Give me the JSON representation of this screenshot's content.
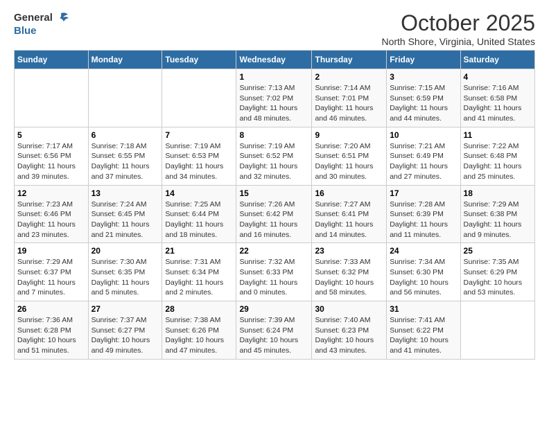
{
  "header": {
    "logo_line1": "General",
    "logo_line2": "Blue",
    "month": "October 2025",
    "location": "North Shore, Virginia, United States"
  },
  "weekdays": [
    "Sunday",
    "Monday",
    "Tuesday",
    "Wednesday",
    "Thursday",
    "Friday",
    "Saturday"
  ],
  "weeks": [
    [
      {
        "day": "",
        "content": ""
      },
      {
        "day": "",
        "content": ""
      },
      {
        "day": "",
        "content": ""
      },
      {
        "day": "1",
        "content": "Sunrise: 7:13 AM\nSunset: 7:02 PM\nDaylight: 11 hours and 48 minutes."
      },
      {
        "day": "2",
        "content": "Sunrise: 7:14 AM\nSunset: 7:01 PM\nDaylight: 11 hours and 46 minutes."
      },
      {
        "day": "3",
        "content": "Sunrise: 7:15 AM\nSunset: 6:59 PM\nDaylight: 11 hours and 44 minutes."
      },
      {
        "day": "4",
        "content": "Sunrise: 7:16 AM\nSunset: 6:58 PM\nDaylight: 11 hours and 41 minutes."
      }
    ],
    [
      {
        "day": "5",
        "content": "Sunrise: 7:17 AM\nSunset: 6:56 PM\nDaylight: 11 hours and 39 minutes."
      },
      {
        "day": "6",
        "content": "Sunrise: 7:18 AM\nSunset: 6:55 PM\nDaylight: 11 hours and 37 minutes."
      },
      {
        "day": "7",
        "content": "Sunrise: 7:19 AM\nSunset: 6:53 PM\nDaylight: 11 hours and 34 minutes."
      },
      {
        "day": "8",
        "content": "Sunrise: 7:19 AM\nSunset: 6:52 PM\nDaylight: 11 hours and 32 minutes."
      },
      {
        "day": "9",
        "content": "Sunrise: 7:20 AM\nSunset: 6:51 PM\nDaylight: 11 hours and 30 minutes."
      },
      {
        "day": "10",
        "content": "Sunrise: 7:21 AM\nSunset: 6:49 PM\nDaylight: 11 hours and 27 minutes."
      },
      {
        "day": "11",
        "content": "Sunrise: 7:22 AM\nSunset: 6:48 PM\nDaylight: 11 hours and 25 minutes."
      }
    ],
    [
      {
        "day": "12",
        "content": "Sunrise: 7:23 AM\nSunset: 6:46 PM\nDaylight: 11 hours and 23 minutes."
      },
      {
        "day": "13",
        "content": "Sunrise: 7:24 AM\nSunset: 6:45 PM\nDaylight: 11 hours and 21 minutes."
      },
      {
        "day": "14",
        "content": "Sunrise: 7:25 AM\nSunset: 6:44 PM\nDaylight: 11 hours and 18 minutes."
      },
      {
        "day": "15",
        "content": "Sunrise: 7:26 AM\nSunset: 6:42 PM\nDaylight: 11 hours and 16 minutes."
      },
      {
        "day": "16",
        "content": "Sunrise: 7:27 AM\nSunset: 6:41 PM\nDaylight: 11 hours and 14 minutes."
      },
      {
        "day": "17",
        "content": "Sunrise: 7:28 AM\nSunset: 6:39 PM\nDaylight: 11 hours and 11 minutes."
      },
      {
        "day": "18",
        "content": "Sunrise: 7:29 AM\nSunset: 6:38 PM\nDaylight: 11 hours and 9 minutes."
      }
    ],
    [
      {
        "day": "19",
        "content": "Sunrise: 7:29 AM\nSunset: 6:37 PM\nDaylight: 11 hours and 7 minutes."
      },
      {
        "day": "20",
        "content": "Sunrise: 7:30 AM\nSunset: 6:35 PM\nDaylight: 11 hours and 5 minutes."
      },
      {
        "day": "21",
        "content": "Sunrise: 7:31 AM\nSunset: 6:34 PM\nDaylight: 11 hours and 2 minutes."
      },
      {
        "day": "22",
        "content": "Sunrise: 7:32 AM\nSunset: 6:33 PM\nDaylight: 11 hours and 0 minutes."
      },
      {
        "day": "23",
        "content": "Sunrise: 7:33 AM\nSunset: 6:32 PM\nDaylight: 10 hours and 58 minutes."
      },
      {
        "day": "24",
        "content": "Sunrise: 7:34 AM\nSunset: 6:30 PM\nDaylight: 10 hours and 56 minutes."
      },
      {
        "day": "25",
        "content": "Sunrise: 7:35 AM\nSunset: 6:29 PM\nDaylight: 10 hours and 53 minutes."
      }
    ],
    [
      {
        "day": "26",
        "content": "Sunrise: 7:36 AM\nSunset: 6:28 PM\nDaylight: 10 hours and 51 minutes."
      },
      {
        "day": "27",
        "content": "Sunrise: 7:37 AM\nSunset: 6:27 PM\nDaylight: 10 hours and 49 minutes."
      },
      {
        "day": "28",
        "content": "Sunrise: 7:38 AM\nSunset: 6:26 PM\nDaylight: 10 hours and 47 minutes."
      },
      {
        "day": "29",
        "content": "Sunrise: 7:39 AM\nSunset: 6:24 PM\nDaylight: 10 hours and 45 minutes."
      },
      {
        "day": "30",
        "content": "Sunrise: 7:40 AM\nSunset: 6:23 PM\nDaylight: 10 hours and 43 minutes."
      },
      {
        "day": "31",
        "content": "Sunrise: 7:41 AM\nSunset: 6:22 PM\nDaylight: 10 hours and 41 minutes."
      },
      {
        "day": "",
        "content": ""
      }
    ]
  ]
}
